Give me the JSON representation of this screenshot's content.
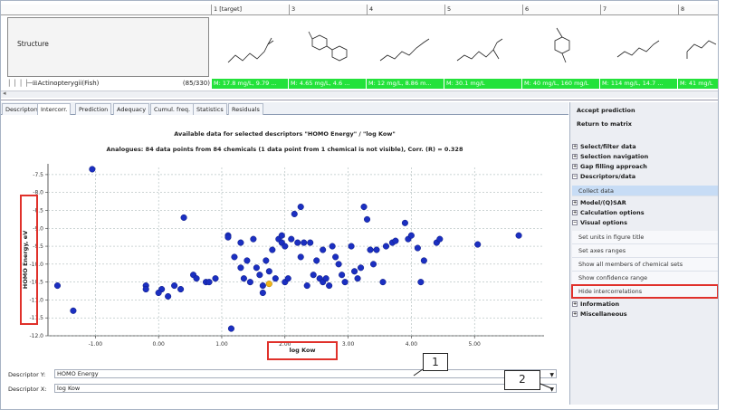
{
  "grid": {
    "columns": [
      "1 [target]",
      "3",
      "4",
      "5",
      "6",
      "7",
      "8"
    ],
    "structure_label": "Structure",
    "fish_row_label": "Actinopterygii(Fish)",
    "fish_row_count": "(85/330)",
    "fish_values": [
      "M: 17.8 mg/L, 9.79 ...",
      "M: 4.65 mg/L, 4.6 ...",
      "M: 12 mg/L, 8.86 m...",
      "M: 30.1 mg/L",
      "M: 40 mg/L, 160 mg/L",
      "M: 114 mg/L, 14.7 ...",
      "M: 41 mg/L"
    ]
  },
  "tabs": [
    "Descriptors",
    "Intercorr.",
    "Prediction",
    "Adequacy",
    "Cumul. freq.",
    "Statistics",
    "Residuals"
  ],
  "active_tab": "Intercorr.",
  "chart_titles": {
    "heading": "Available data for selected descriptors \"HOMO Energy\" / \"log Kow\"",
    "subheading": "Analogues:  84 data points from 84 chemicals (1 data point from 1 chemical is not visible), Corr. (R) = 0.328"
  },
  "chart_data": {
    "type": "scatter",
    "xlabel": "log Kow",
    "ylabel": "HOMO Energy, eV",
    "xlim": [
      -1.75,
      6.1
    ],
    "ylim": [
      -12.0,
      -7.3
    ],
    "xticks": [
      -1.0,
      0.0,
      1.0,
      2.0,
      3.0,
      4.0,
      5.0
    ],
    "yticks": [
      -7.5,
      -8.0,
      -8.5,
      -9.0,
      -9.5,
      -10.0,
      -10.5,
      -11.0,
      -11.5,
      -12.0
    ],
    "xtick_labels": [
      "-1.00",
      "0.00",
      "1.00",
      "2.00",
      "3.00",
      "4.00",
      "5.00"
    ],
    "ytick_labels": [
      "-7.5",
      "-8.0",
      "-8.5",
      "-9.0",
      "-9.5",
      "-10.0",
      "-10.5",
      "-11.0",
      "-11.5",
      "-12.0"
    ],
    "grid": true,
    "colors": {
      "points": "#1b2fc1",
      "highlight": "#f2b516"
    },
    "points": [
      [
        -1.05,
        -7.35
      ],
      [
        -1.6,
        -10.6
      ],
      [
        -1.35,
        -11.3
      ],
      [
        -0.2,
        -10.6
      ],
      [
        -0.2,
        -10.7
      ],
      [
        0.05,
        -10.7
      ],
      [
        0.15,
        -10.9
      ],
      [
        0.25,
        -10.6
      ],
      [
        0.35,
        -10.7
      ],
      [
        0.4,
        -8.7
      ],
      [
        0.55,
        -10.3
      ],
      [
        0.6,
        -10.4
      ],
      [
        0.75,
        -10.5
      ],
      [
        0.8,
        -10.5
      ],
      [
        0.9,
        -10.4
      ],
      [
        1.1,
        -9.2
      ],
      [
        1.15,
        -11.8
      ],
      [
        1.2,
        -9.8
      ],
      [
        1.3,
        -9.4
      ],
      [
        1.35,
        -10.4
      ],
      [
        1.4,
        -9.9
      ],
      [
        1.45,
        -10.5
      ],
      [
        1.5,
        -9.3
      ],
      [
        1.55,
        -10.1
      ],
      [
        1.6,
        -10.3
      ],
      [
        1.65,
        -10.6
      ],
      [
        1.65,
        -10.8
      ],
      [
        1.7,
        -9.9
      ],
      [
        1.75,
        -10.2
      ],
      [
        1.8,
        -9.6
      ],
      [
        1.85,
        -10.4
      ],
      [
        1.9,
        -9.3
      ],
      [
        1.95,
        -9.2
      ],
      [
        1.95,
        -9.4
      ],
      [
        2.0,
        -10.5
      ],
      [
        2.0,
        -9.5
      ],
      [
        2.05,
        -10.4
      ],
      [
        2.1,
        -9.3
      ],
      [
        2.15,
        -8.6
      ],
      [
        2.2,
        -9.4
      ],
      [
        2.25,
        -8.4
      ],
      [
        2.25,
        -9.8
      ],
      [
        2.3,
        -9.4
      ],
      [
        2.35,
        -10.6
      ],
      [
        2.4,
        -9.4
      ],
      [
        2.45,
        -10.3
      ],
      [
        2.5,
        -9.9
      ],
      [
        2.55,
        -10.4
      ],
      [
        2.6,
        -10.5
      ],
      [
        2.6,
        -9.6
      ],
      [
        2.65,
        -10.4
      ],
      [
        2.7,
        -10.6
      ],
      [
        2.75,
        -9.5
      ],
      [
        2.8,
        -9.8
      ],
      [
        2.85,
        -10.0
      ],
      [
        2.9,
        -10.3
      ],
      [
        2.95,
        -10.5
      ],
      [
        3.05,
        -9.5
      ],
      [
        3.1,
        -10.2
      ],
      [
        3.15,
        -10.4
      ],
      [
        3.2,
        -10.1
      ],
      [
        3.25,
        -8.4
      ],
      [
        3.3,
        -8.75
      ],
      [
        3.35,
        -9.6
      ],
      [
        3.4,
        -10.0
      ],
      [
        3.45,
        -9.6
      ],
      [
        3.55,
        -10.5
      ],
      [
        3.6,
        -9.5
      ],
      [
        3.7,
        -9.4
      ],
      [
        3.75,
        -9.35
      ],
      [
        3.9,
        -8.85
      ],
      [
        3.95,
        -9.3
      ],
      [
        4.0,
        -9.2
      ],
      [
        4.1,
        -9.55
      ],
      [
        4.15,
        -10.5
      ],
      [
        4.2,
        -9.9
      ],
      [
        4.4,
        -9.4
      ],
      [
        4.45,
        -9.3
      ],
      [
        5.05,
        -9.45
      ],
      [
        5.7,
        -9.2
      ],
      [
        1.1,
        -9.25
      ],
      [
        1.3,
        -10.1
      ],
      [
        0.0,
        -10.8
      ]
    ],
    "highlight_point": [
      1.75,
      -10.55
    ]
  },
  "descriptors": {
    "y_label": "Descriptor Y:",
    "y_value": "HOMO Energy",
    "x_label": "Descriptor X:",
    "x_value": "log Kow"
  },
  "callouts": {
    "one": "1",
    "two": "2"
  },
  "sidebar": {
    "top_buttons": [
      "Accept prediction",
      "Return to matrix"
    ],
    "sections": [
      {
        "label": "Select/filter data",
        "expanded": false
      },
      {
        "label": "Selection navigation",
        "expanded": false
      },
      {
        "label": "Gap filling approach",
        "expanded": false
      },
      {
        "label": "Descriptors/data",
        "expanded": true,
        "items": [
          "Collect data"
        ]
      },
      {
        "label": "Model/(Q)SAR",
        "expanded": false
      },
      {
        "label": "Calculation options",
        "expanded": false
      },
      {
        "label": "Visual options",
        "expanded": true,
        "items": [
          "Set units in figure title",
          "Set axes ranges",
          "Show all members of chemical sets",
          "Show confidence range",
          "Hide intercorrelations"
        ]
      },
      {
        "label": "Information",
        "expanded": false
      },
      {
        "label": "Miscellaneous",
        "expanded": false
      }
    ]
  }
}
